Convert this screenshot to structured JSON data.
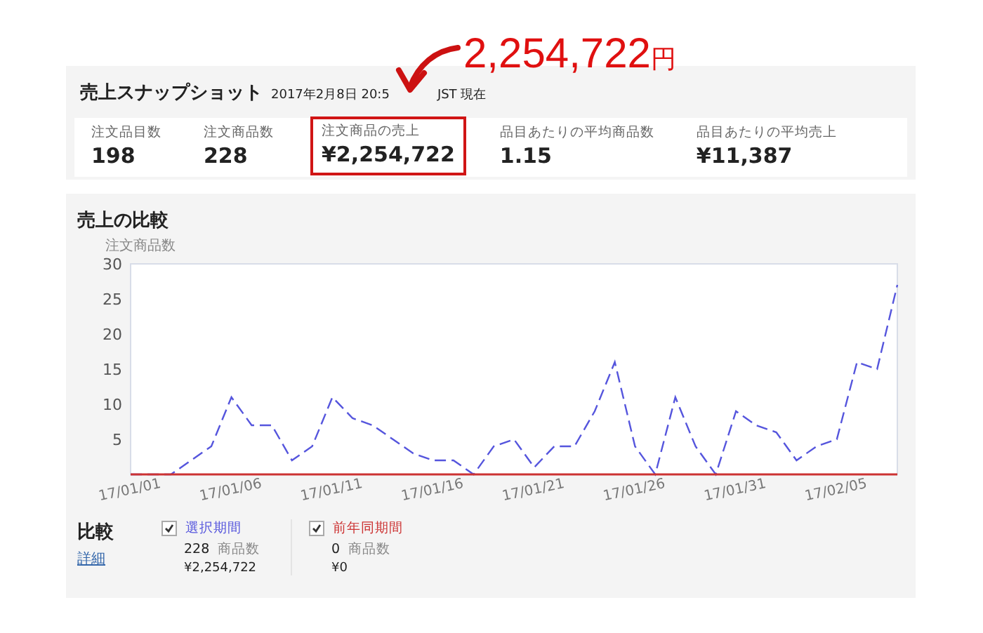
{
  "annotation": {
    "amount": "2,254,722",
    "unit": "円"
  },
  "snapshot": {
    "title": "売上スナップショット",
    "timestamp": "2017年2月8日 20:5",
    "timestamp_tail": "JST 現在",
    "metrics": [
      {
        "label": "注文品目数",
        "value": "198",
        "highlighted": false
      },
      {
        "label": "注文商品数",
        "value": "228",
        "highlighted": false
      },
      {
        "label": "注文商品の売上",
        "value": "¥2,254,722",
        "highlighted": true
      },
      {
        "label": "品目あたりの平均商品数",
        "value": "1.15",
        "highlighted": false
      },
      {
        "label": "品目あたりの平均売上",
        "value": "¥11,387",
        "highlighted": false
      }
    ]
  },
  "comparison": {
    "title": "売上の比較",
    "chart_data": {
      "type": "line",
      "ylabel": "注文商品数",
      "ylim": [
        0,
        30
      ],
      "yticks": [
        5,
        10,
        15,
        20,
        25,
        30
      ],
      "categories": [
        "17/01/01",
        null,
        null,
        null,
        null,
        "17/01/06",
        null,
        null,
        null,
        null,
        "17/01/11",
        null,
        null,
        null,
        null,
        "17/01/16",
        null,
        null,
        null,
        null,
        "17/01/21",
        null,
        null,
        null,
        null,
        "17/01/26",
        null,
        null,
        null,
        null,
        "17/01/31",
        null,
        null,
        null,
        null,
        "17/02/05",
        null,
        null,
        null
      ],
      "series": [
        {
          "name": "選択期間",
          "color": "#5555dd",
          "line_style": "dashed",
          "values": [
            0,
            0,
            0,
            2,
            4,
            11,
            7,
            7,
            2,
            4,
            11,
            8,
            7,
            5,
            3,
            2,
            2,
            0,
            4,
            5,
            1,
            4,
            4,
            9,
            16,
            4,
            0,
            11,
            4,
            0,
            9,
            7,
            6,
            2,
            4,
            5,
            16,
            15,
            27
          ]
        },
        {
          "name": "前年同期間",
          "color": "#cc3333",
          "line_style": "solid",
          "values": [
            0,
            0,
            0,
            0,
            0,
            0,
            0,
            0,
            0,
            0,
            0,
            0,
            0,
            0,
            0,
            0,
            0,
            0,
            0,
            0,
            0,
            0,
            0,
            0,
            0,
            0,
            0,
            0,
            0,
            0,
            0,
            0,
            0,
            0,
            0,
            0,
            0,
            0,
            0
          ]
        }
      ]
    },
    "legend": {
      "title": "比較",
      "link": "詳細",
      "series": [
        {
          "checked": true,
          "count": "228",
          "count_unit": "商品数",
          "sales": "¥2,254,722"
        },
        {
          "checked": true,
          "count": "0",
          "count_unit": "商品数",
          "sales": "¥0"
        }
      ]
    }
  }
}
